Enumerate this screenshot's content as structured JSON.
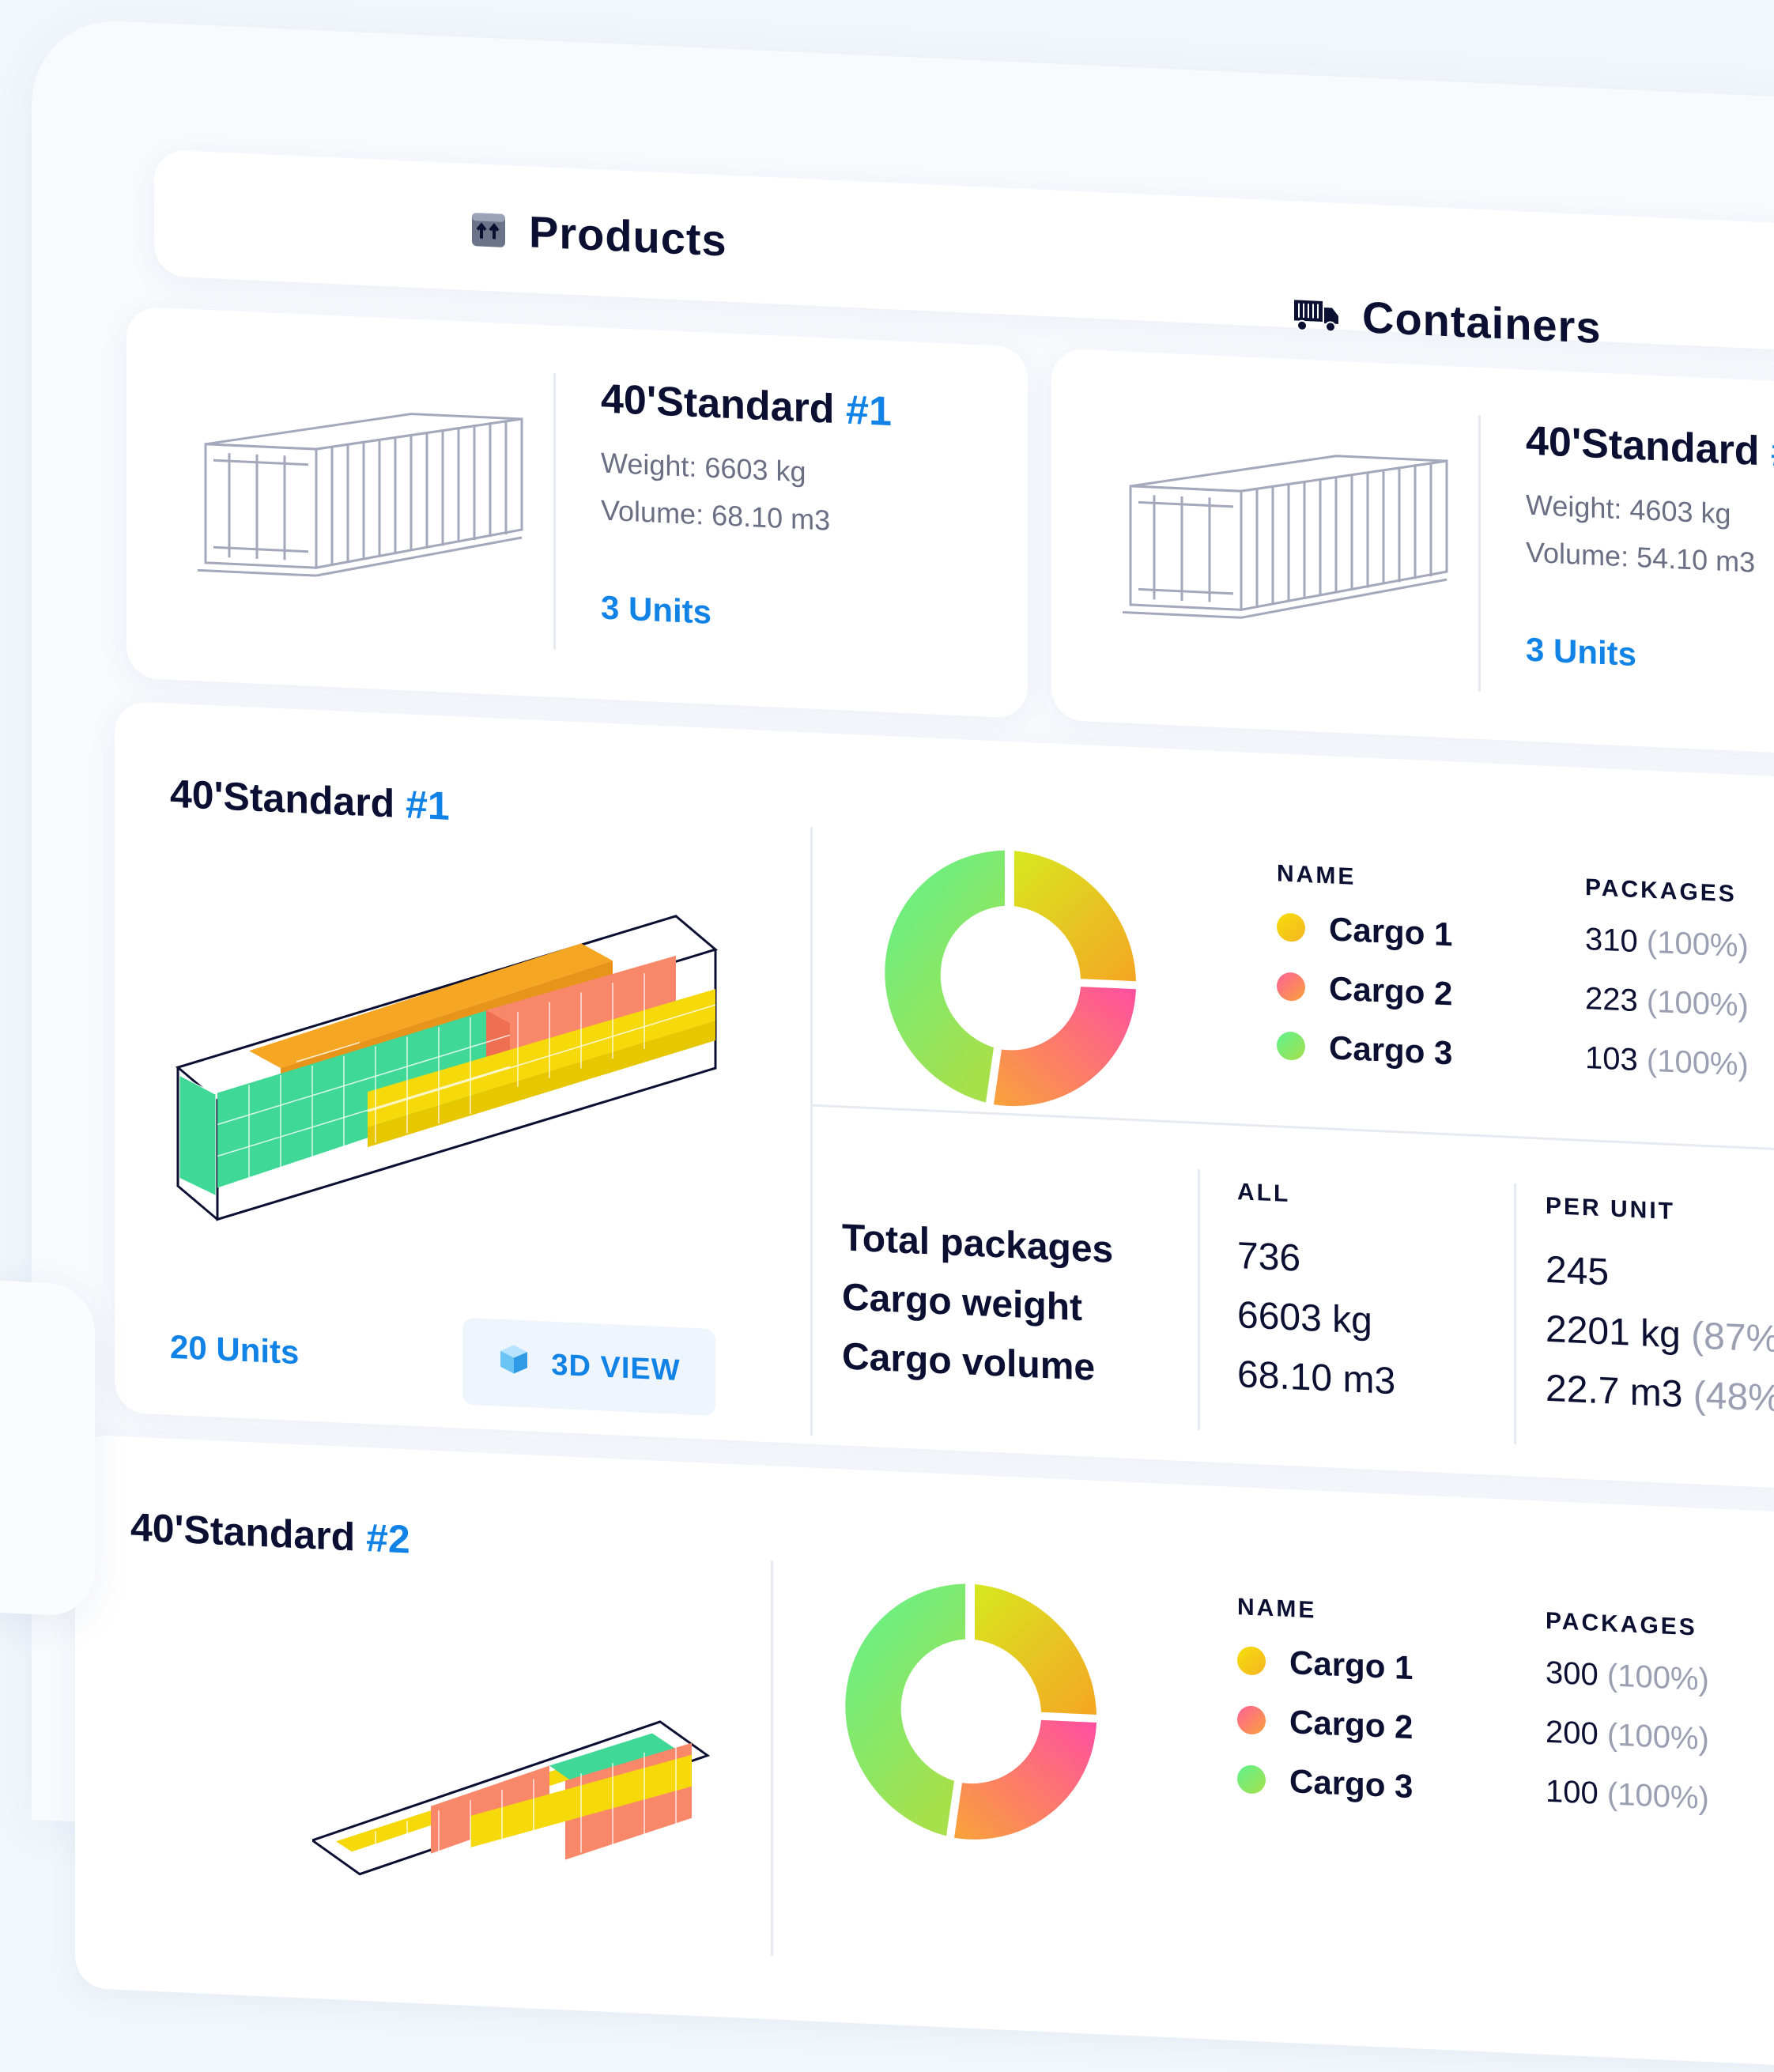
{
  "tabs": {
    "products": "Products",
    "containers": "Containers"
  },
  "containers": [
    {
      "name": "40'Standard",
      "number": "#1",
      "weight": "Weight: 6603 kg",
      "volume": "Volume: 68.10 m3",
      "units": "3 Units"
    },
    {
      "name": "40'Standard",
      "number": "#",
      "weight": "Weight: 4603 kg",
      "volume": "Volume: 54.10 m3",
      "units": "3 Units"
    }
  ],
  "sections": [
    {
      "name": "40'Standard",
      "number": "#1",
      "units": "20 Units",
      "view_button": "3D VIEW",
      "name_header": "NAME",
      "packages_header": "PACKAGES",
      "cargo": [
        {
          "name": "Cargo 1",
          "packages": "310",
          "pct": "(100%)"
        },
        {
          "name": "Cargo 2",
          "packages": "223",
          "pct": "(100%)"
        },
        {
          "name": "Cargo 3",
          "packages": "103",
          "pct": "(100%)"
        }
      ],
      "stats": {
        "labels": [
          "Total packages",
          "Cargo weight",
          "Cargo volume"
        ],
        "all_header": "ALL",
        "all": [
          "736",
          "6603 kg",
          "68.10 m3"
        ],
        "per_unit_header": "PER UNIT",
        "per_unit": [
          "245",
          "2201 kg",
          "22.7 m3"
        ],
        "per_unit_pct": [
          "",
          "(87%",
          "(48%"
        ]
      }
    },
    {
      "name": "40'Standard",
      "number": "#2",
      "name_header": "NAME",
      "packages_header": "PACKAGES",
      "cargo": [
        {
          "name": "Cargo 1",
          "packages": "300",
          "pct": "(100%)"
        },
        {
          "name": "Cargo 2",
          "packages": "200",
          "pct": "(100%)"
        },
        {
          "name": "Cargo 3",
          "packages": "100",
          "pct": "(100%)"
        }
      ]
    }
  ],
  "colors": {
    "accent": "#1283e6",
    "cargo1": "#f5d90a",
    "cargo2": "#f9876a",
    "cargo3": "#5ee08a",
    "cargo_orange": "#f5a623",
    "cargo_green": "#3fd897"
  }
}
